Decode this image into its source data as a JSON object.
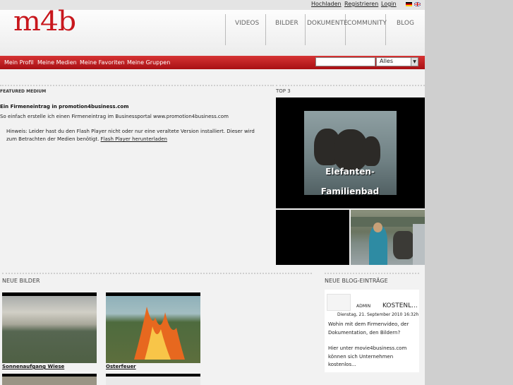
{
  "topbar": {
    "links": [
      "Hochladen",
      "Registrieren",
      "Login"
    ]
  },
  "logo": "m4b",
  "nav": {
    "items": [
      "VIDEOS",
      "BILDER",
      "DOKUMENTE",
      "COMMUNITY",
      "BLOG"
    ]
  },
  "subnav": {
    "items": [
      "Mein Profil",
      "Meine Medien",
      "Meine Favoriten",
      "Meine Gruppen"
    ]
  },
  "search": {
    "value": "",
    "filter": "Alles"
  },
  "featured": {
    "heading": "FEATURED MEDIUM",
    "title": "Ein Firmeneintrag in promotion4business.com",
    "description": "So einfach erstelle ich einen Firmeneintrag im Businessportal www.promotion4business.com",
    "hint": "Hinweis: Leider hast du den Flash Player nicht oder nur eine veraltete Version installiert. Dieser wird zum Betrachten der Medien benötigt.",
    "hint_link": "Flash Player herunterladen"
  },
  "top3": {
    "heading": "TOP 3",
    "main_caption_1": "Elefanten-",
    "main_caption_2": "Familienbad"
  },
  "neue_bilder": {
    "heading": "NEUE BILDER",
    "items": [
      "Sonnenaufgang Wiese",
      "Osterfeuer"
    ]
  },
  "blog": {
    "heading": "NEUE BLOG-EINTRÄGE",
    "author": "ADMIN",
    "title": "KOSTENL...",
    "date": "Dienstag, 21. September 2010 16:32h",
    "text_1": "Wohin mit dem Firmenvideo, der Dokumentation, den Bildern?",
    "text_2": "Hier unter movie4business.com können sich Unternehmen kostenlos..."
  },
  "colors": {
    "brand_red": "#c8171d",
    "bar_red": "#b71c20"
  }
}
